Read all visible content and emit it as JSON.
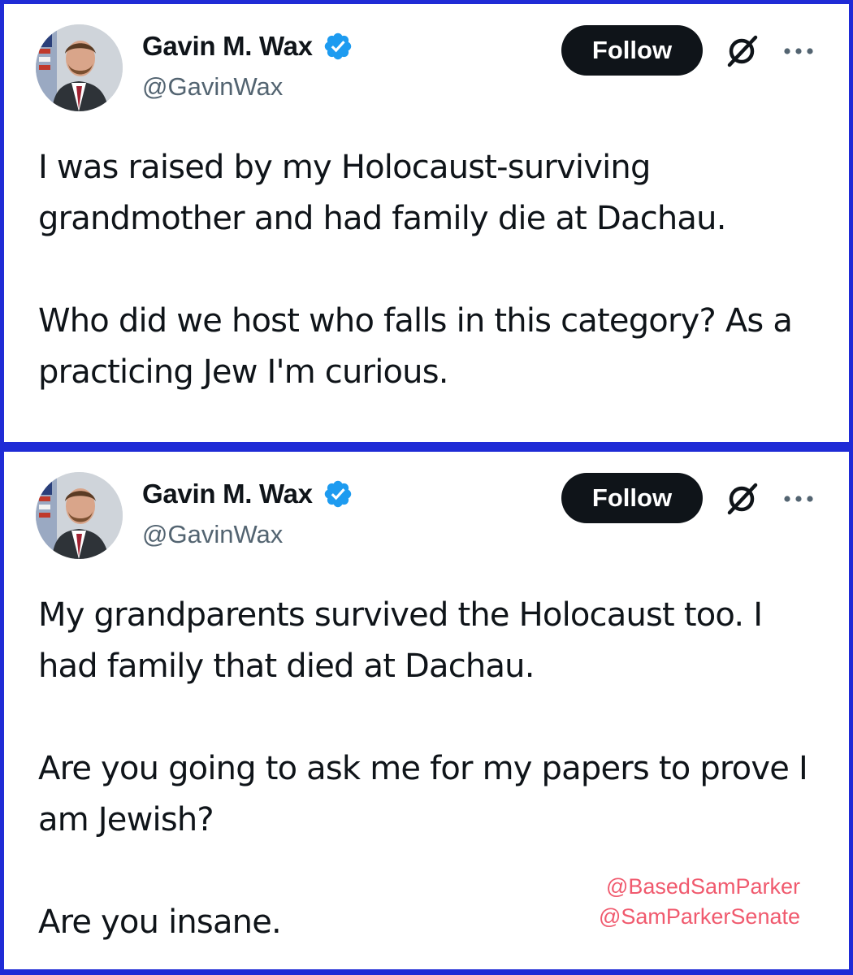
{
  "tweets": [
    {
      "author": {
        "name": "Gavin M. Wax",
        "handle": "@GavinWax"
      },
      "follow_label": "Follow",
      "paragraphs": [
        "I was raised by my Holocaust-surviving\ngrandmother and had family die at Dachau.",
        "Who did we host who falls in this category? As a\npracticing Jew I'm curious."
      ]
    },
    {
      "author": {
        "name": "Gavin M. Wax",
        "handle": "@GavinWax"
      },
      "follow_label": "Follow",
      "paragraphs": [
        "My grandparents survived the Holocaust too. I\nhad family that died at Dachau.",
        "Are you going to ask me for my papers to prove I\nam Jewish?",
        "Are you insane."
      ]
    }
  ],
  "watermark": {
    "line1": "@BasedSamParker",
    "line2": "@SamParkerSenate"
  },
  "colors": {
    "frame": "#1f2bd6",
    "verified": "#1d9bf0",
    "follow_bg": "#0f1419",
    "watermark": "#f05a6e"
  }
}
